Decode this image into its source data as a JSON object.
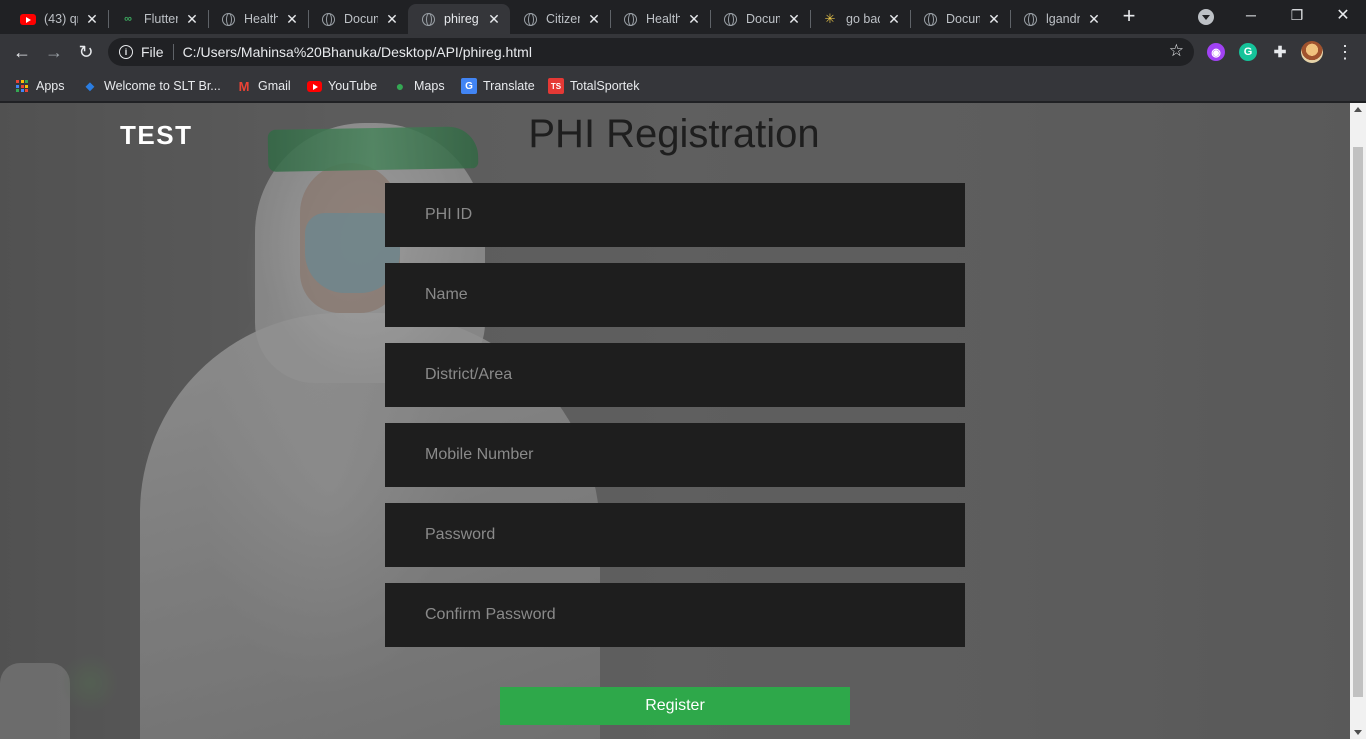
{
  "browser": {
    "tabs": [
      {
        "title": "(43) qr",
        "favicon": "youtube-icon",
        "active": false
      },
      {
        "title": "Flutter",
        "favicon": "flutter-icon",
        "active": false
      },
      {
        "title": "Health",
        "favicon": "globe-icon",
        "active": false
      },
      {
        "title": "Docum",
        "favicon": "globe-icon",
        "active": false
      },
      {
        "title": "phireg",
        "favicon": "globe-icon",
        "active": true
      },
      {
        "title": "Citizen",
        "favicon": "globe-icon",
        "active": false
      },
      {
        "title": "Health",
        "favicon": "globe-icon",
        "active": false
      },
      {
        "title": "Docum",
        "favicon": "globe-icon",
        "active": false
      },
      {
        "title": "go bac",
        "favicon": "star-burst-icon",
        "active": false
      },
      {
        "title": "Docum",
        "favicon": "globe-icon",
        "active": false
      },
      {
        "title": "lgandr",
        "favicon": "globe-icon",
        "active": false
      }
    ],
    "address": {
      "scheme_label": "File",
      "url": "C:/Users/Mahinsa%20Bhanuka/Desktop/API/phireg.html"
    },
    "bookmarks": [
      {
        "label": "Apps",
        "icon": "apps-grid-icon"
      },
      {
        "label": "Welcome to SLT Br...",
        "icon": "slt-icon"
      },
      {
        "label": "Gmail",
        "icon": "gmail-icon"
      },
      {
        "label": "YouTube",
        "icon": "youtube-icon"
      },
      {
        "label": "Maps",
        "icon": "maps-icon"
      },
      {
        "label": "Translate",
        "icon": "translate-icon"
      },
      {
        "label": "TotalSportek",
        "icon": "totalsportek-icon"
      }
    ],
    "accent_colors": {
      "tab_bg": "#202124",
      "toolbar_bg": "#35363a"
    }
  },
  "page": {
    "brand": "TEST",
    "title": "PHI Registration",
    "fields": [
      {
        "placeholder": "PHI ID",
        "type": "text"
      },
      {
        "placeholder": "Name",
        "type": "text"
      },
      {
        "placeholder": "District/Area",
        "type": "text"
      },
      {
        "placeholder": "Mobile Number",
        "type": "text"
      },
      {
        "placeholder": "Password",
        "type": "password"
      },
      {
        "placeholder": "Confirm Password",
        "type": "password"
      }
    ],
    "register_label": "Register",
    "colors": {
      "field_bg": "#1e1e1e",
      "button_bg": "#2ea84a"
    }
  }
}
